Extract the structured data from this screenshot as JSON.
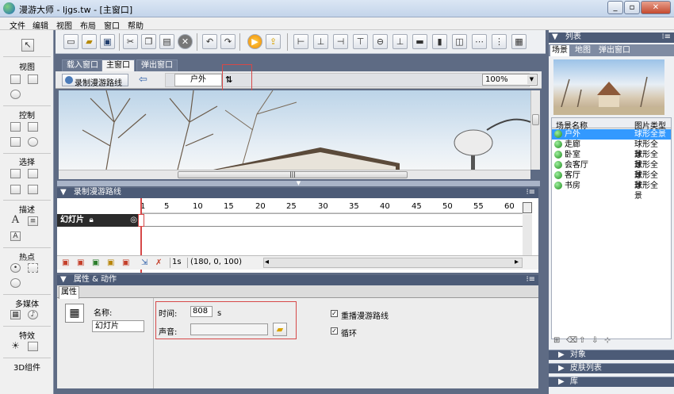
{
  "window": {
    "title": "漫游大师 - ljgs.tw - [主窗口]",
    "min": "_",
    "restore": "▫",
    "close": "✕"
  },
  "menu": [
    "文件",
    "编辑",
    "视图",
    "布局",
    "窗口",
    "帮助"
  ],
  "left_panel": {
    "sections": [
      "视图",
      "控制",
      "选择",
      "描述",
      "热点",
      "多媒体",
      "特效",
      "3D组件"
    ]
  },
  "tabs": [
    "载入窗口",
    "主窗口",
    "弹出窗口"
  ],
  "subbar": {
    "record_label": "录制漫游路线",
    "scene_tab": "户外",
    "zoom": "100%"
  },
  "timeline": {
    "title": "录制漫游路线",
    "ticks": [
      "1",
      "5",
      "10",
      "15",
      "20",
      "25",
      "30",
      "35",
      "40",
      "45",
      "50",
      "55",
      "60"
    ],
    "track_name": "幻灯片",
    "time_field": "1s",
    "coord_field": "(180, 0, 100)"
  },
  "properties": {
    "title": "属性 & 动作",
    "tab": "属性",
    "name_label": "名称:",
    "name_value": "幻灯片",
    "time_label": "时间:",
    "time_value": "808",
    "time_unit": "s",
    "sound_label": "声音:",
    "sound_value": "",
    "replay_label": "重播漫游路线",
    "replay_checked": true,
    "loop_label": "循环",
    "loop_checked": true
  },
  "right_panel": {
    "title": "列表",
    "tabs": [
      "场景",
      "地图",
      "弹出窗口"
    ],
    "col_name": "场景名称",
    "col_type": "图片类型",
    "scenes": [
      {
        "name": "户外",
        "type": "球形全景",
        "selected": true
      },
      {
        "name": "走廊",
        "type": "球形全景",
        "selected": false
      },
      {
        "name": "卧室",
        "type": "球形全景",
        "selected": false
      },
      {
        "name": "会客厅",
        "type": "球形全景",
        "selected": false
      },
      {
        "name": "客厅",
        "type": "球形全景",
        "selected": false
      },
      {
        "name": "书房",
        "type": "球形全景",
        "selected": false
      }
    ],
    "bottom_sections": [
      "对象",
      "皮肤列表",
      "库"
    ]
  },
  "colors": {
    "selection": "#3399ff",
    "panel_header": "#4c5b77",
    "highlight_box": "#d64848",
    "playhead": "#d64848"
  }
}
